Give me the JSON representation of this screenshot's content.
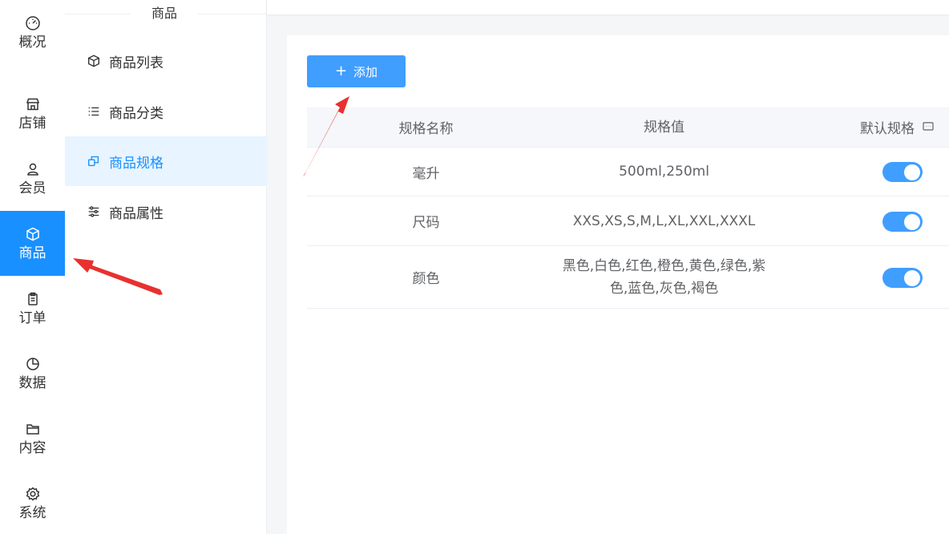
{
  "nav": {
    "items": [
      {
        "label": "概况",
        "icon": "gauge-icon"
      },
      {
        "label": "店铺",
        "icon": "shop-icon"
      },
      {
        "label": "会员",
        "icon": "user-icon"
      },
      {
        "label": "商品",
        "icon": "box-icon",
        "active": true
      },
      {
        "label": "订单",
        "icon": "clipboard-icon"
      },
      {
        "label": "数据",
        "icon": "pie-chart-icon"
      },
      {
        "label": "内容",
        "icon": "folder-icon"
      },
      {
        "label": "系统",
        "icon": "gear-icon"
      }
    ]
  },
  "submenu": {
    "title": "商品",
    "items": [
      {
        "label": "商品列表",
        "icon": "box-icon"
      },
      {
        "label": "商品分类",
        "icon": "list-icon"
      },
      {
        "label": "商品规格",
        "icon": "copy-icon",
        "active": true
      },
      {
        "label": "商品属性",
        "icon": "sliders-icon"
      }
    ]
  },
  "toolbar": {
    "add_label": "添加",
    "add_icon": "+"
  },
  "table": {
    "headers": [
      "规格名称",
      "规格值",
      "默认规格"
    ],
    "rows": [
      {
        "name": "毫升",
        "value": "500ml,250ml",
        "default": true
      },
      {
        "name": "尺码",
        "value": "XXS,XS,S,M,L,XL,XXL,XXXL",
        "default": true
      },
      {
        "name": "颜色",
        "value": "黑色,白色,红色,橙色,黄色,绿色,紫色,蓝色,灰色,褐色",
        "default": true
      }
    ]
  },
  "colors": {
    "primary": "#1890ff",
    "button": "#409eff",
    "annotation": "#e8312f"
  }
}
